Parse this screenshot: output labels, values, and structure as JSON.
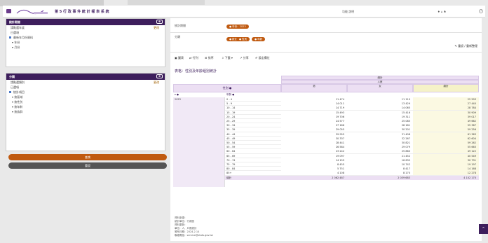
{
  "header": {
    "site_title": "第 5 行 政 事 件 統 計 報 表 系 統",
    "site_subtitle": "",
    "links": "功能  說明",
    "right_text": "♦ ⌂ ♣",
    "help": "?"
  },
  "sidebar": {
    "panel1": {
      "title": "統計期間",
      "toggle": "⊕",
      "rows": [
        {
          "label": "請點選年度",
          "right": "更改",
          "type": "plain"
        },
        {
          "label": "已選項",
          "type": "plain"
        },
        {
          "label": "最新年月份資料",
          "type": "check"
        },
        {
          "label": "▾ 年份",
          "type": "sub"
        },
        {
          "label": "▾ 月份",
          "type": "sub"
        }
      ]
    },
    "panel2": {
      "title": "分類",
      "toggle": "⊕",
      "rows": [
        {
          "label": "請點選類別",
          "right": "更改",
          "type": "plain"
        },
        {
          "label": "已選項",
          "type": "plain"
        },
        {
          "label": "統計項目",
          "type": "check"
        },
        {
          "label": "▾ 按區域",
          "type": "sub"
        },
        {
          "label": "▾ 按性別",
          "type": "sub"
        },
        {
          "label": "▾ 按年齡",
          "type": "sub"
        },
        {
          "label": "▾ 按族群",
          "type": "sub"
        }
      ]
    },
    "submit_label": "查詢",
    "clear_label": "重設"
  },
  "filters": {
    "label1": "統計期間",
    "chip1": "● 年份：2023",
    "label2": "分類",
    "chips2": [
      "● 統計",
      "● 性別",
      "● 年齡"
    ],
    "reset": "✎ 重設 / 重新整理"
  },
  "toolbar": {
    "items": [
      "▣ 圖表",
      "⇄ 行列",
      "⊞ 排序",
      "⇩ 下載 ▾",
      "↗ 分享",
      "✐ 設定欄位"
    ]
  },
  "table": {
    "title": "表格：性別及年齡組別統計",
    "col_header_top": "總計",
    "col_header_mid": "人數",
    "row_header_label": "性別 ●",
    "age_header_label": "年齡 ●",
    "year_label": "▾ ●",
    "year_value": "2023",
    "columns": [
      "男",
      "女",
      "總計"
    ],
    "rows": [
      {
        "age": "0 - 4",
        "m": "11 474",
        "f": "11 119",
        "t": "22 593"
      },
      {
        "age": "5 - 9",
        "m": "14 011",
        "f": "13 429",
        "t": "27 440"
      },
      {
        "age": "10 - 14",
        "m": "14 719",
        "f": "14 065",
        "t": "28 784"
      },
      {
        "age": "15 - 19",
        "m": "15 493",
        "f": "15 416",
        "t": "30 909"
      },
      {
        "age": "20 - 24",
        "m": "19 706",
        "f": "19 311",
        "t": "39 017"
      },
      {
        "age": "25 - 29",
        "m": "24 577",
        "f": "25 085",
        "t": "49 662"
      },
      {
        "age": "30 - 34",
        "m": "27 186",
        "f": "28 181",
        "t": "55 367"
      },
      {
        "age": "35 - 39",
        "m": "29 055",
        "f": "30 201",
        "t": "59 256"
      },
      {
        "age": "40 - 44",
        "m": "29 955",
        "f": "31 408",
        "t": "61 363"
      },
      {
        "age": "45 - 49",
        "m": "30 337",
        "f": "32 267",
        "t": "62 604"
      },
      {
        "age": "50 - 54",
        "m": "28 441",
        "f": "30 821",
        "t": "59 262"
      },
      {
        "age": "55 - 59",
        "m": "26 584",
        "f": "29 079",
        "t": "55 663"
      },
      {
        "age": "60 - 64",
        "m": "23 242",
        "f": "25 880",
        "t": "49 122"
      },
      {
        "age": "65 - 69",
        "m": "19 097",
        "f": "21 452",
        "t": "40 549"
      },
      {
        "age": "70 - 74",
        "m": "14 159",
        "f": "16 632",
        "t": "30 791"
      },
      {
        "age": "75 - 79",
        "m": "8 455",
        "f": "10 742",
        "t": "19 197"
      },
      {
        "age": "80 - 84",
        "m": "5 751",
        "f": "8 417",
        "t": "14 168"
      },
      {
        "age": "85+",
        "m": "4 108",
        "f": "8 170",
        "t": "12 278"
      }
    ],
    "total": {
      "age": "總計",
      "m": "2 062 487",
      "f": "2 039 683",
      "t": "4 102 170"
    }
  },
  "notes": [
    "資料來源：",
    "統計單位：行政區",
    "資料更新：",
    "單位：人、戶數統計",
    "發布日期：2024.2.14",
    "聯絡電話：service@stats.gov.tw"
  ]
}
